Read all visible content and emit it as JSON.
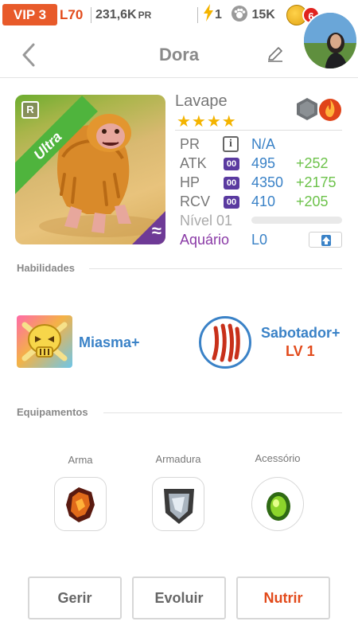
{
  "status_bar": {
    "vip": "VIP 3",
    "level": "L70",
    "power": "231,6K",
    "power_unit": "PR",
    "energy": "1",
    "paws": "15K",
    "notifications": "6"
  },
  "header": {
    "title": "Dora"
  },
  "pet": {
    "name": "Lavape",
    "stars": "★★★★",
    "rarity_letter": "R",
    "rarity": "Ultra",
    "element_symbol": "≈",
    "stats": {
      "pr": {
        "label": "PR",
        "chip": "i",
        "value": "N/A"
      },
      "atk": {
        "label": "ATK",
        "chip": "00",
        "value": "495",
        "bonus": "+252"
      },
      "hp": {
        "label": "HP",
        "chip": "00",
        "value": "4350",
        "bonus": "+2175"
      },
      "rcv": {
        "label": "RCV",
        "chip": "00",
        "value": "410",
        "bonus": "+205"
      },
      "level": {
        "label": "Nível 01",
        "progress": 0
      },
      "aquario": {
        "label": "Aquário",
        "value": "L0"
      }
    }
  },
  "abilities": {
    "title": "Habilidades",
    "items": [
      {
        "name": "Miasma+"
      },
      {
        "name": "Sabotador+",
        "level": "LV 1"
      }
    ]
  },
  "equipment": {
    "title": "Equipamentos",
    "slots": [
      {
        "label": "Arma"
      },
      {
        "label": "Armadura"
      },
      {
        "label": "Acessório"
      }
    ]
  },
  "actions": {
    "manage": "Gerir",
    "evolve": "Evoluir",
    "feed": "Nutrir"
  },
  "colors": {
    "accent_orange": "#e24a1b",
    "link_blue": "#3a82c7",
    "bonus_green": "#6cc24a",
    "star_gold": "#f4b400",
    "chip_purple": "#5a3aa0"
  }
}
